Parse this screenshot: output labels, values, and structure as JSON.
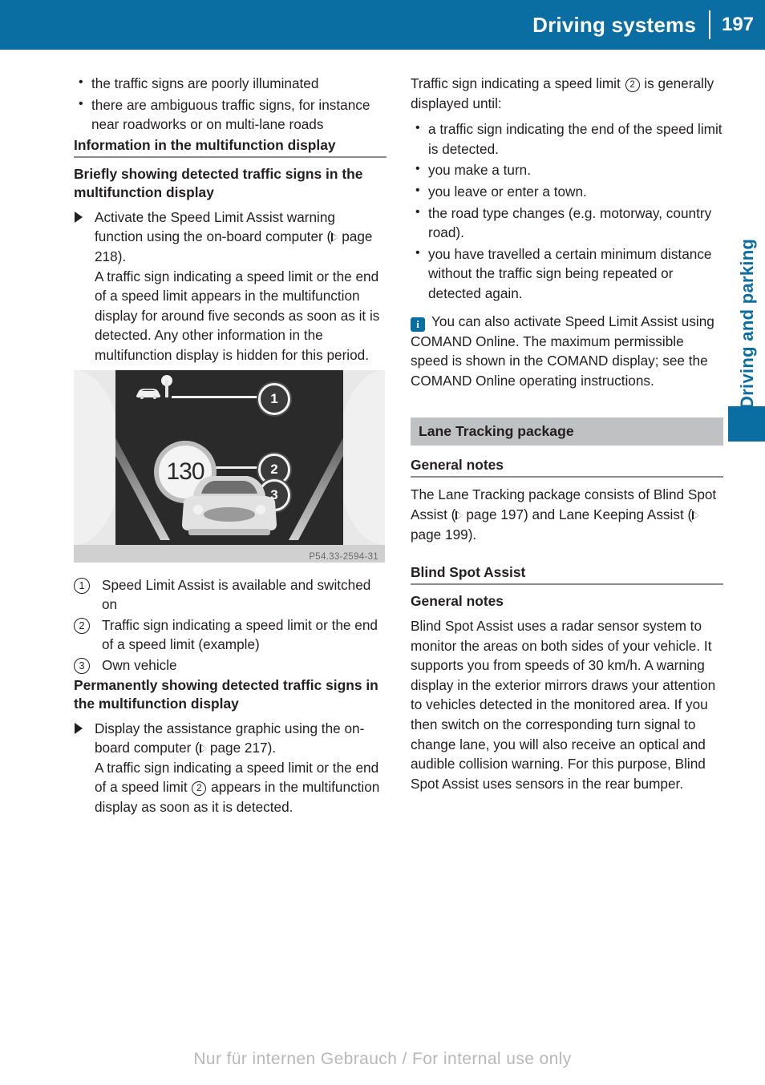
{
  "header": {
    "title": "Driving systems",
    "page_number": "197",
    "bg_color": "#0a6ea3"
  },
  "side_tab": {
    "label": "Driving and parking",
    "color": "#0a6ea3"
  },
  "left_column": {
    "intro_bullets": [
      "the traffic signs are poorly illuminated",
      "there are ambiguous traffic signs, for instance near roadworks or on multi-lane roads"
    ],
    "section_heading": "Information in the multifunction display",
    "sub_heading_1": "Briefly showing detected traffic signs in the multifunction display",
    "step_1_line_a": "Activate the Speed Limit Assist warning function using the on-board computer (",
    "step_1_ref": "page 218",
    "step_1_line_b": ").",
    "step_1_body": "A traffic sign indicating a speed limit or the end of a speed limit appears in the multifunction display for around five seconds as soon as it is detected. Any other information in the multifunction display is hidden for this period.",
    "figure": {
      "caption_code": "P54.33-2594-31",
      "sign_value": "130",
      "callout_labels": [
        "1",
        "2",
        "3"
      ]
    },
    "callouts": [
      {
        "num": "1",
        "text": "Speed Limit Assist is available and switched on"
      },
      {
        "num": "2",
        "text": "Traffic sign indicating a speed limit or the end of a speed limit (example)"
      },
      {
        "num": "3",
        "text": "Own vehicle"
      }
    ],
    "sub_heading_2": "Permanently showing detected traffic signs in the multifunction display",
    "step_2_line_a": "Display the assistance graphic using the on-board computer (",
    "step_2_ref": "page 217",
    "step_2_line_b": ").",
    "step_2_body_a": "A traffic sign indicating a speed limit or the end of a speed limit ",
    "step_2_marker": "2",
    "step_2_body_b": " appears in the multifunction display as soon as it is detected."
  },
  "right_column": {
    "lead_a": "Traffic sign indicating a speed limit ",
    "lead_marker": "2",
    "lead_b": " is generally displayed until:",
    "bullets": [
      "a traffic sign indicating the end of the speed limit is detected.",
      "you make a turn.",
      "you leave or enter a town.",
      "the road type changes (e.g. motorway, country road).",
      "you have travelled a certain minimum distance without the traffic sign being repeated or detected again."
    ],
    "note": {
      "icon": "info-icon",
      "text": "You can also activate Speed Limit Assist using COMAND Online. The maximum permissible speed is shown in the COMAND display; see the COMAND Online operating instructions."
    },
    "band_heading": "Lane Tracking package",
    "general_notes_heading_1": "General notes",
    "general_notes_body_a": "The Lane Tracking package consists of Blind Spot Assist (",
    "general_notes_ref_1": "page 197",
    "general_notes_body_b": ") and Lane Keeping Assist (",
    "general_notes_ref_2": "page 199",
    "general_notes_body_c": ").",
    "blind_spot_heading": "Blind Spot Assist",
    "general_notes_heading_2": "General notes",
    "blind_spot_body": "Blind Spot Assist uses a radar sensor system to monitor the areas on both sides of your vehicle. It supports you from speeds of 30 km/h. A warning display in the exterior mirrors draws your attention to vehicles detected in the monitored area. If you then switch on the corresponding turn signal to change lane, you will also receive an optical and audible collision warning. For this purpose, Blind Spot Assist uses sensors in the rear bumper."
  },
  "footer": {
    "text": "Nur für internen Gebrauch / For internal use only"
  }
}
